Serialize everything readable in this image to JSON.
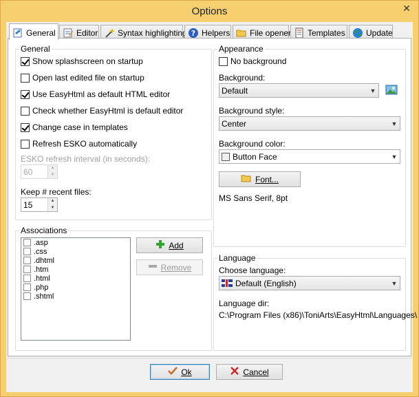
{
  "window": {
    "title": "Options",
    "close_glyph": "✕"
  },
  "tabs": [
    {
      "label": "General",
      "icon": "general-icon"
    },
    {
      "label": "Editor",
      "icon": "editor-icon"
    },
    {
      "label": "Syntax highlighting",
      "icon": "wand-icon"
    },
    {
      "label": "Helpers",
      "icon": "help-icon"
    },
    {
      "label": "File opener",
      "icon": "folder-icon"
    },
    {
      "label": "Templates",
      "icon": "document-icon"
    },
    {
      "label": "Update",
      "icon": "globe-icon"
    }
  ],
  "general": {
    "legend": "General",
    "options": [
      {
        "label": "Show splashscreen on startup",
        "checked": true
      },
      {
        "label": "Open last edited file on startup",
        "checked": false
      },
      {
        "label": "Use EasyHtml as default HTML editor",
        "checked": true
      },
      {
        "label": "Check whether EasyHtml is default editor",
        "checked": false
      },
      {
        "label": "Change case in templates",
        "checked": true
      },
      {
        "label": "Refresh ESKO automatically",
        "checked": false
      }
    ],
    "esko_label": "ESKO refresh interval (in seconds):",
    "esko_value": "60",
    "recent_label": "Keep # recent files:",
    "recent_value": "15"
  },
  "associations": {
    "legend": "Associations",
    "items": [
      ".asp",
      ".css",
      ".dhtml",
      ".htm",
      ".html",
      ".php",
      ".shtml"
    ],
    "add_label": "Add",
    "remove_label": "Remove"
  },
  "appearance": {
    "legend": "Appearance",
    "no_background_label": "No background",
    "background_label": "Background:",
    "background_value": "Default",
    "style_label": "Background style:",
    "style_value": "Center",
    "color_label": "Background color:",
    "color_value": "Button Face",
    "font_button": "Font...",
    "font_value": "MS Sans Serif, 8pt"
  },
  "language": {
    "legend": "Language",
    "choose_label": "Choose language:",
    "choose_value": "Default (English)",
    "dir_label": "Language dir:",
    "dir_value": "C:\\Program Files (x86)\\ToniArts\\EasyHtml\\Languages\\"
  },
  "footer": {
    "ok_label": "Ok",
    "cancel_label": "Cancel"
  },
  "colors": {
    "title_accent": "#f6cf6e",
    "add_green": "#2ea52e",
    "cancel_red": "#cc2a2a",
    "ok_green": "#cc6a2a"
  }
}
